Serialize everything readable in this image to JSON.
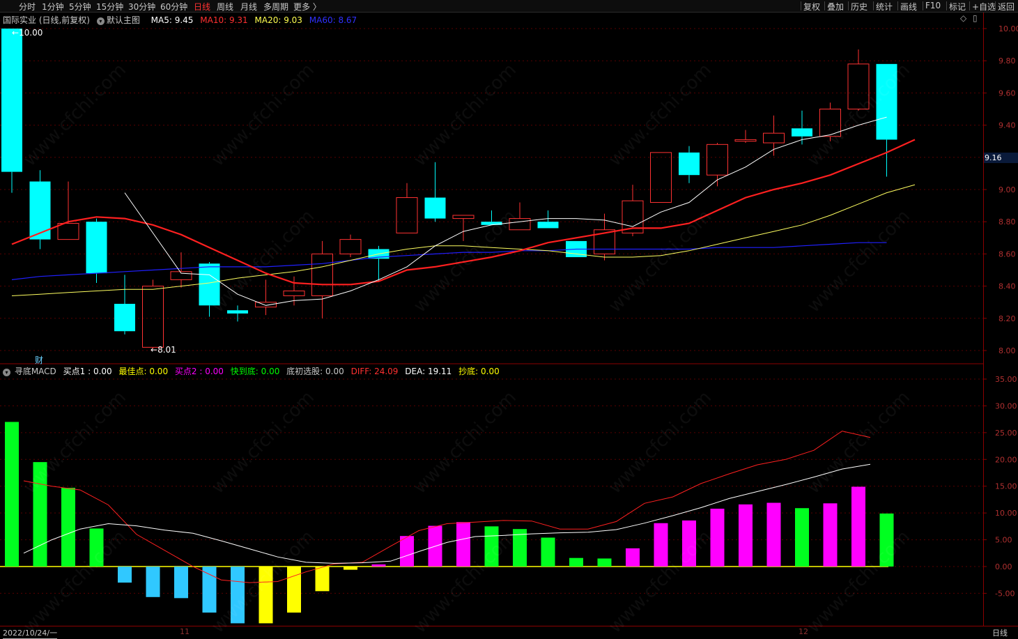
{
  "toolbar": {
    "periods": [
      "分时",
      "1分钟",
      "5分钟",
      "15分钟",
      "30分钟",
      "60分钟",
      "日线",
      "周线",
      "月线",
      "多周期",
      "更多 〉"
    ],
    "active_period": "日线",
    "right_items": [
      "复权",
      "叠加",
      "历史",
      "统计",
      "画线",
      "F10",
      "标记",
      "+自选",
      "返回"
    ]
  },
  "main_legend": {
    "stock": "国际实业 (日线,前复权)",
    "template": "默认主图",
    "ma5": "MA5: 9.45",
    "ma10": "MA10: 9.31",
    "ma20": "MA20: 9.03",
    "ma60": "MA60: 8.67"
  },
  "markers": {
    "high": "10.00",
    "low": "8.01",
    "cai": "财",
    "diamond": "◇",
    "menu": "▯"
  },
  "current_price": "9.16",
  "sub_legend": {
    "name": "寻底MACD",
    "buy1": "买点1 : 0.00",
    "best": "最佳点: 0.00",
    "buy2": "买点2 : 0.00",
    "fast": "快到底: 0.00",
    "bottom_pick": "底初选股: 0.00",
    "diff": "DIFF: 24.09",
    "dea": "DEA: 19.11",
    "chaodi": "抄底: 0.00"
  },
  "bottom": {
    "date": "2022/10/24/一",
    "m11": "11",
    "m12": "12",
    "period": "日线"
  },
  "watermark": "www.cfchi.com",
  "colors": {
    "up": "#ff3232",
    "down": "#00ffff",
    "ma5": "#ffffff",
    "ma10": "#ff2020",
    "ma20": "#ffff60",
    "ma60": "#2020ff"
  },
  "chart_data": [
    {
      "type": "candlestick",
      "ylim": [
        7.95,
        10.05
      ],
      "yticks": [
        "10.00",
        "9.80",
        "9.60",
        "9.40",
        "9.20",
        "9.00",
        "8.80",
        "8.60",
        "8.40",
        "8.20",
        "8.00"
      ],
      "candles": [
        {
          "o": 10.0,
          "h": 10.0,
          "l": 8.98,
          "c": 9.11
        },
        {
          "o": 9.05,
          "h": 9.12,
          "l": 8.63,
          "c": 8.69
        },
        {
          "o": 8.69,
          "h": 9.05,
          "l": 8.69,
          "c": 8.79
        },
        {
          "o": 8.8,
          "h": 8.82,
          "l": 8.42,
          "c": 8.48
        },
        {
          "o": 8.29,
          "h": 8.47,
          "l": 8.1,
          "c": 8.12
        },
        {
          "o": 8.02,
          "h": 8.44,
          "l": 8.01,
          "c": 8.4
        },
        {
          "o": 8.44,
          "h": 8.61,
          "l": 8.39,
          "c": 8.49
        },
        {
          "o": 8.54,
          "h": 8.55,
          "l": 8.21,
          "c": 8.28
        },
        {
          "o": 8.25,
          "h": 8.28,
          "l": 8.18,
          "c": 8.23
        },
        {
          "o": 8.27,
          "h": 8.44,
          "l": 8.22,
          "c": 8.3
        },
        {
          "o": 8.34,
          "h": 8.46,
          "l": 8.28,
          "c": 8.37
        },
        {
          "o": 8.34,
          "h": 8.68,
          "l": 8.2,
          "c": 8.6
        },
        {
          "o": 8.6,
          "h": 8.72,
          "l": 8.58,
          "c": 8.69
        },
        {
          "o": 8.63,
          "h": 8.65,
          "l": 8.43,
          "c": 8.57
        },
        {
          "o": 8.73,
          "h": 9.04,
          "l": 8.73,
          "c": 8.95
        },
        {
          "o": 8.95,
          "h": 9.17,
          "l": 8.8,
          "c": 8.82
        },
        {
          "o": 8.82,
          "h": 8.84,
          "l": 8.68,
          "c": 8.84
        },
        {
          "o": 8.8,
          "h": 8.87,
          "l": 8.78,
          "c": 8.78
        },
        {
          "o": 8.75,
          "h": 8.92,
          "l": 8.75,
          "c": 8.82
        },
        {
          "o": 8.8,
          "h": 8.87,
          "l": 8.76,
          "c": 8.76
        },
        {
          "o": 8.68,
          "h": 8.68,
          "l": 8.58,
          "c": 8.58
        },
        {
          "o": 8.6,
          "h": 8.85,
          "l": 8.56,
          "c": 8.75
        },
        {
          "o": 8.73,
          "h": 9.03,
          "l": 8.71,
          "c": 8.93
        },
        {
          "o": 8.92,
          "h": 9.23,
          "l": 8.92,
          "c": 9.23
        },
        {
          "o": 9.23,
          "h": 9.27,
          "l": 9.04,
          "c": 9.09
        },
        {
          "o": 9.09,
          "h": 9.29,
          "l": 9.02,
          "c": 9.28
        },
        {
          "o": 9.3,
          "h": 9.37,
          "l": 9.29,
          "c": 9.31
        },
        {
          "o": 9.29,
          "h": 9.46,
          "l": 9.21,
          "c": 9.35
        },
        {
          "o": 9.38,
          "h": 9.49,
          "l": 9.28,
          "c": 9.33
        },
        {
          "o": 9.33,
          "h": 9.54,
          "l": 9.3,
          "c": 9.5
        },
        {
          "o": 9.5,
          "h": 9.87,
          "l": 9.49,
          "c": 9.78
        },
        {
          "o": 9.78,
          "h": 9.78,
          "l": 9.08,
          "c": 9.31
        }
      ],
      "ma5": [
        null,
        null,
        null,
        null,
        8.98,
        8.73,
        8.48,
        8.47,
        8.35,
        8.28,
        8.31,
        8.32,
        8.37,
        8.44,
        8.52,
        8.65,
        8.74,
        8.78,
        8.8,
        8.82,
        8.82,
        8.81,
        8.77,
        8.86,
        8.92,
        9.06,
        9.14,
        9.25,
        9.31,
        9.34,
        9.4,
        9.45
      ],
      "ma10": [
        8.66,
        8.73,
        8.8,
        8.83,
        8.82,
        8.78,
        8.72,
        8.64,
        8.56,
        8.48,
        8.42,
        8.41,
        8.41,
        8.43,
        8.5,
        8.52,
        8.55,
        8.58,
        8.62,
        8.67,
        8.7,
        8.73,
        8.76,
        8.76,
        8.79,
        8.87,
        8.95,
        9.0,
        9.04,
        9.09,
        9.16,
        9.23,
        9.31
      ],
      "ma20": [
        8.34,
        8.35,
        8.36,
        8.37,
        8.38,
        8.38,
        8.4,
        8.42,
        8.45,
        8.47,
        8.49,
        8.52,
        8.56,
        8.6,
        8.63,
        8.65,
        8.65,
        8.64,
        8.63,
        8.62,
        8.6,
        8.58,
        8.58,
        8.59,
        8.62,
        8.66,
        8.7,
        8.74,
        8.78,
        8.84,
        8.91,
        8.98,
        9.03
      ],
      "ma60": [
        8.44,
        8.46,
        8.47,
        8.48,
        8.49,
        8.5,
        8.51,
        8.52,
        8.52,
        8.52,
        8.53,
        8.54,
        8.56,
        8.58,
        8.59,
        8.6,
        8.61,
        8.61,
        8.62,
        8.62,
        8.63,
        8.63,
        8.63,
        8.63,
        8.63,
        8.64,
        8.64,
        8.64,
        8.65,
        8.66,
        8.67,
        8.67
      ]
    },
    {
      "type": "bar",
      "ylim": [
        -11,
        37
      ],
      "yticks": [
        "35.00",
        "30.00",
        "25.00",
        "20.00",
        "15.00",
        "10.00",
        "5.00",
        "0.00",
        "-5.00"
      ],
      "macd": [
        27.0,
        19.5,
        14.7,
        7.1,
        -3.0,
        -5.7,
        -5.9,
        -8.6,
        -10.6,
        -10.6,
        -8.6,
        -4.6,
        -0.6,
        0.4,
        5.7,
        7.6,
        8.3,
        7.5,
        7.0,
        5.4,
        1.6,
        1.5,
        3.4,
        8.1,
        8.6,
        10.8,
        11.6,
        11.9,
        10.9,
        11.8,
        14.9,
        9.9
      ],
      "macd_colors": [
        "green",
        "green",
        "green",
        "green",
        "cyan",
        "cyan",
        "cyan",
        "cyan",
        "cyan",
        "yellow",
        "yellow",
        "yellow",
        "yellow",
        "magenta",
        "magenta",
        "magenta",
        "magenta",
        "green",
        "green",
        "green",
        "green",
        "green",
        "magenta",
        "magenta",
        "magenta",
        "magenta",
        "magenta",
        "magenta",
        "green",
        "magenta",
        "magenta",
        "green"
      ],
      "diff": [
        16.0,
        15.0,
        14.3,
        11.5,
        6.0,
        3.0,
        0.0,
        -2.5,
        -3.0,
        -2.8,
        -1.0,
        0.5,
        0.8,
        3.8,
        6.7,
        8.0,
        8.3,
        8.6,
        8.5,
        7.0,
        7.0,
        8.4,
        11.8,
        13.0,
        15.5,
        17.3,
        19.0,
        20.0,
        21.7,
        25.3,
        24.1
      ],
      "dea": [
        2.5,
        5.0,
        7.0,
        8.0,
        7.6,
        6.8,
        6.2,
        4.8,
        3.3,
        1.8,
        0.8,
        0.6,
        0.7,
        1.0,
        2.8,
        4.5,
        5.6,
        5.8,
        6.1,
        6.3,
        6.4,
        6.9,
        8.1,
        9.5,
        11.0,
        12.7,
        14.0,
        15.3,
        16.7,
        18.2,
        19.1
      ]
    }
  ]
}
